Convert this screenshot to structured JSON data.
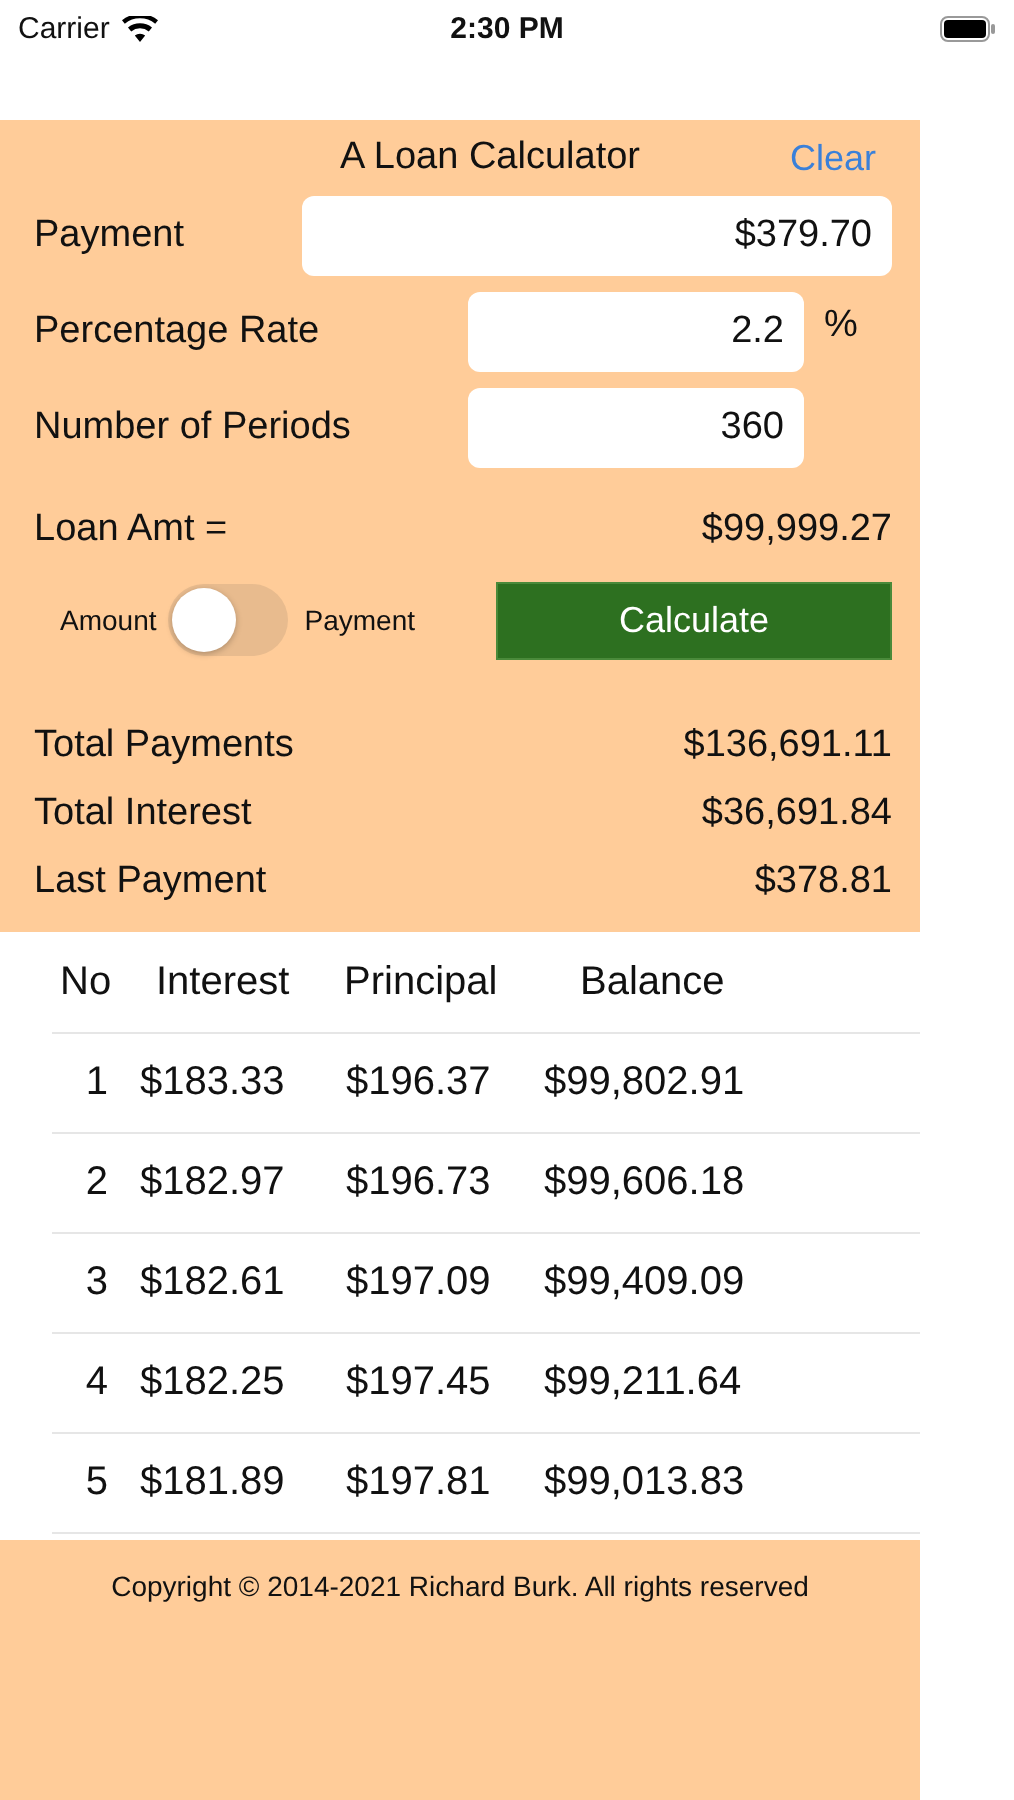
{
  "status_bar": {
    "carrier": "Carrier",
    "time": "2:30 PM"
  },
  "calculator": {
    "title": "A Loan Calculator",
    "clear_button": "Clear",
    "fields": [
      {
        "label": "Payment",
        "value": "$379.70",
        "kind": "wide"
      },
      {
        "label": "Percentage Rate",
        "value": "2.2",
        "kind": "unit",
        "unit": "%"
      },
      {
        "label": "Number of Periods",
        "value": "360",
        "kind": "narrow"
      }
    ],
    "loan_amount": {
      "label": "Loan Amt =",
      "value": "$99,999.27"
    },
    "mode_switch": {
      "left_label": "Amount",
      "right_label": "Payment",
      "on": false
    },
    "calculate_button": "Calculate",
    "totals": [
      {
        "label": "Total Payments",
        "value": "$136,691.11"
      },
      {
        "label": "Total Interest",
        "value": "$36,691.84"
      },
      {
        "label": "Last Payment",
        "value": "$378.81"
      }
    ]
  },
  "table": {
    "columns": [
      "No",
      "Interest",
      "Principal",
      "Balance"
    ],
    "rows": [
      [
        "1",
        "$183.33",
        "$196.37",
        "$99,802.91"
      ],
      [
        "2",
        "$182.97",
        "$196.73",
        "$99,606.18"
      ],
      [
        "3",
        "$182.61",
        "$197.09",
        "$99,409.09"
      ],
      [
        "4",
        "$182.25",
        "$197.45",
        "$99,211.64"
      ],
      [
        "5",
        "$181.89",
        "$197.81",
        "$99,013.83"
      ]
    ]
  },
  "footer": "Copyright © 2014-2021 Richard Burk. All rights reserved"
}
